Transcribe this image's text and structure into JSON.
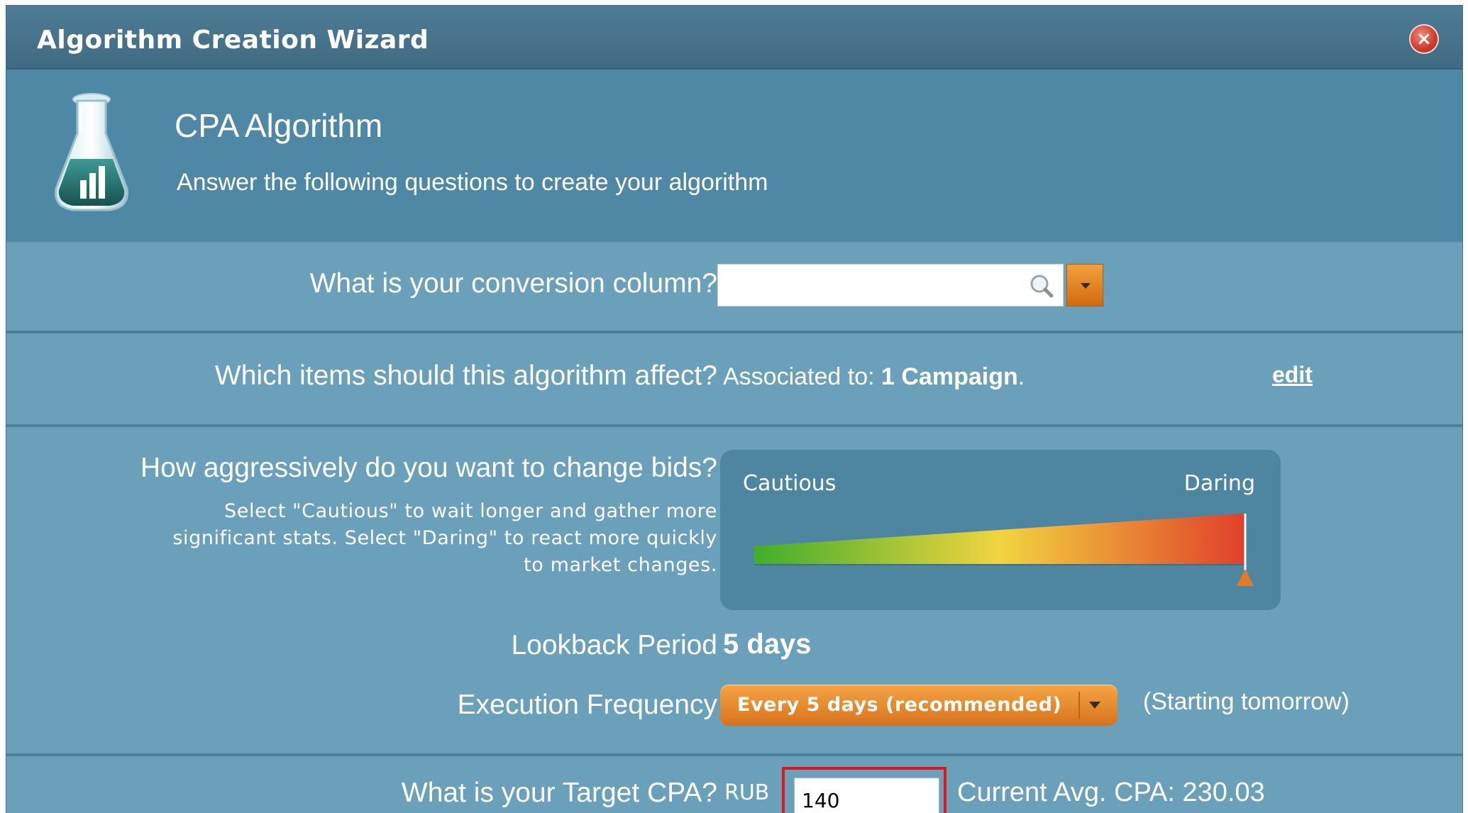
{
  "window": {
    "title": "Algorithm Creation Wizard",
    "close_icon": "close-icon"
  },
  "header": {
    "icon": "flask-chart-icon",
    "title": "CPA Algorithm",
    "subtitle": "Answer the following questions to create your algorithm"
  },
  "conversion": {
    "question": "What is your conversion column?",
    "value": "",
    "search_icon": "magnifier-icon",
    "dropdown_icon": "chevron-down-icon"
  },
  "items": {
    "question": "Which items should this algorithm affect?",
    "associated_label": "Associated to:",
    "associated_value": "1 Campaign",
    "associated_suffix": ".",
    "edit_label": "edit"
  },
  "aggressiveness": {
    "question": "How aggressively do you want to change bids?",
    "help_line1": "Select \"Cautious\" to wait longer and gather more",
    "help_line2": "significant stats. Select \"Daring\" to react more quickly",
    "help_line3": "to market changes.",
    "min_label": "Cautious",
    "max_label": "Daring",
    "level": 1.0,
    "gradient_colors": [
      "#3fae2a",
      "#f2d440",
      "#e0402a"
    ],
    "handle_color": "#e37a2a"
  },
  "lookback": {
    "label": "Lookback Period",
    "value": "5 days"
  },
  "execution": {
    "label": "Execution Frequency",
    "selected": "Every 5 days (recommended)",
    "note": "(Starting tomorrow)"
  },
  "target_cpa": {
    "question": "What is your Target CPA?",
    "currency": "RUB",
    "value": "140",
    "current_avg": "Current Avg. CPA: 230.03",
    "highlight_color": "#e0161a"
  }
}
